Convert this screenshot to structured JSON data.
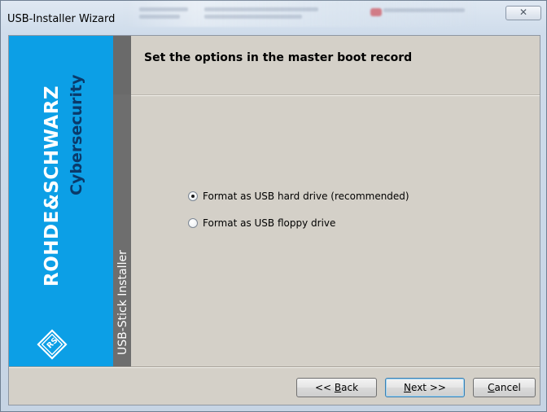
{
  "window": {
    "title": "USB-Installer Wizard",
    "close_glyph": "✕"
  },
  "brand": {
    "company": "ROHDE&SCHWARZ",
    "division": "Cybersecurity",
    "product_strip": "USB-Stick Installer",
    "color": "#0c9fe6"
  },
  "page": {
    "heading": "Set the options in the master boot record"
  },
  "options": [
    {
      "label": "Format as USB hard drive (recommended)",
      "selected": true
    },
    {
      "label": "Format as USB floppy drive",
      "selected": false
    }
  ],
  "buttons": {
    "back": {
      "prefix": "<< ",
      "accel": "B",
      "rest": "ack"
    },
    "next": {
      "accel": "N",
      "rest": "ext >>"
    },
    "cancel": {
      "accel": "C",
      "rest": "ancel"
    }
  }
}
